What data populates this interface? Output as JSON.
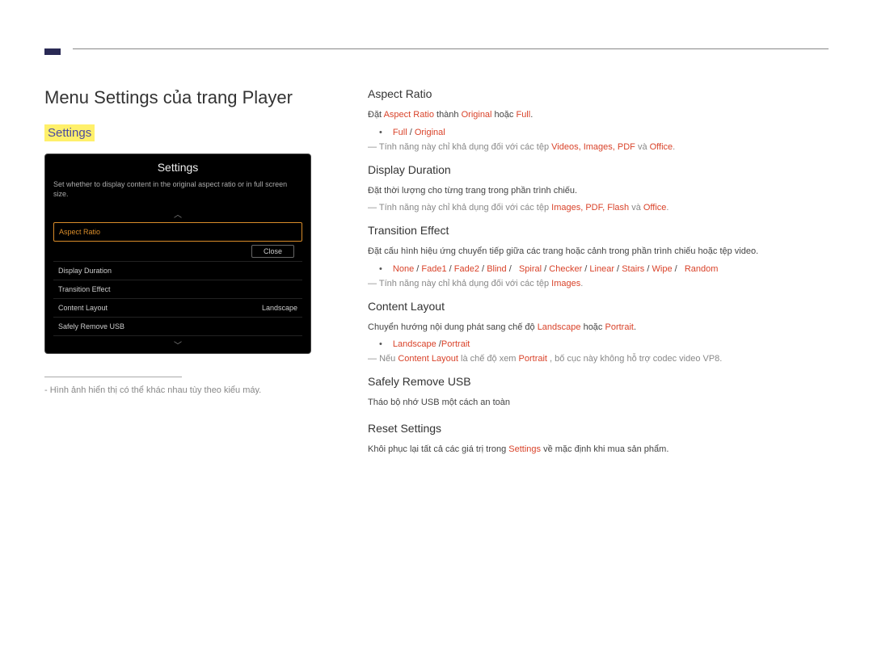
{
  "header": {
    "page_title": "Menu Settings của trang Player",
    "section_label": "Settings"
  },
  "device": {
    "title": "Settings",
    "subtitle": "Set whether to display content in the original aspect ratio or in full screen size.",
    "items": [
      {
        "label": "Aspect Ratio",
        "value": "",
        "selected": true
      },
      {
        "label": "Display Duration",
        "value": ""
      },
      {
        "label": "Transition Effect",
        "value": ""
      },
      {
        "label": "Content Layout",
        "value": "Landscape"
      },
      {
        "label": "Safely Remove USB",
        "value": ""
      }
    ],
    "close": "Close"
  },
  "footnote": "- Hình ảnh hiển thị có thể khác nhau tùy theo kiểu máy.",
  "sections": {
    "aspect_ratio": {
      "title": "Aspect Ratio",
      "line_pre": "Đặt ",
      "line_ar": "Aspect Ratio",
      "line_mid1": " thành ",
      "line_original": "Original",
      "line_mid2": " hoặc ",
      "line_full": "Full",
      "line_end": ".",
      "bullet_full": "Full",
      "bullet_sep": " / ",
      "bullet_original": "Original",
      "note_pre": "Tính năng này chỉ khả dụng đối với các tệp ",
      "note_types": "Videos, Images, PDF",
      "note_mid": " và ",
      "note_office": "Office",
      "note_end": "."
    },
    "display_duration": {
      "title": "Display Duration",
      "line": "Đặt thời lượng cho từng trang trong phần trình chiếu.",
      "note_pre": "Tính năng này chỉ khả dụng đối với các tệp ",
      "note_types": "Images, PDF, Flash",
      "note_mid": " và ",
      "note_office": "Office",
      "note_end": "."
    },
    "transition_effect": {
      "title": "Transition Effect",
      "line": "Đặt cấu hình hiệu ứng chuyển tiếp giữa các trang hoặc cảnh trong phần trình chiếu hoặc tệp video.",
      "options": [
        "None",
        "Fade1",
        "Fade2",
        "Blind",
        "Spiral",
        "Checker",
        "Linear",
        "Stairs",
        "Wipe",
        "Random"
      ],
      "sep": " /",
      "note_pre": "Tính năng này chỉ khả dụng đối với các tệp ",
      "note_images": "Images",
      "note_end": "."
    },
    "content_layout": {
      "title": "Content Layout",
      "line_pre": "Chuyển hướng nội dung phát sang chế độ ",
      "line_landscape": "Landscape",
      "line_mid": " hoặc ",
      "line_portrait": "Portrait",
      "line_end": ".",
      "bullet_landscape": "Landscape",
      "bullet_sep": " /",
      "bullet_portrait": "Portrait",
      "note_pre": "Nếu ",
      "note_cl": "Content Layout",
      "note_mid1": " là chế độ xem ",
      "note_portrait": "Portrait",
      "note_end": " , bố cục này không hỗ trợ codec video VP8."
    },
    "safely_remove_usb": {
      "title": "Safely Remove USB",
      "line": "Tháo bộ nhớ USB một cách an toàn"
    },
    "reset_settings": {
      "title": "Reset Settings",
      "line_pre": "Khôi phục lại tất cả các giá trị trong ",
      "line_settings": "Settings",
      "line_end": " về mặc định khi mua sản phẩm."
    }
  }
}
